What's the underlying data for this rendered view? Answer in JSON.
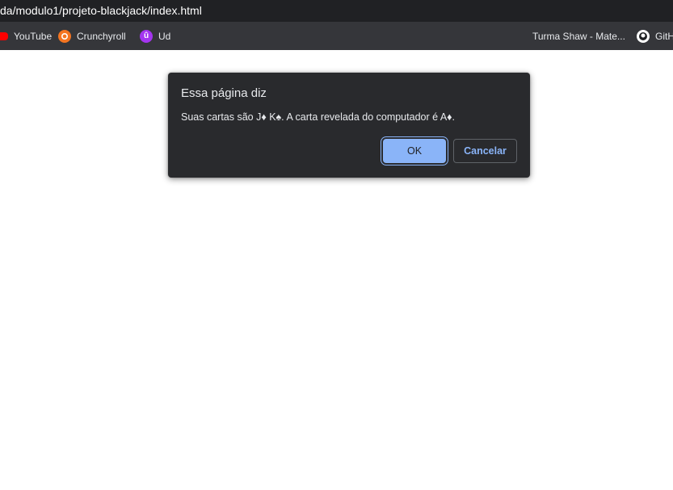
{
  "browser": {
    "url": "da/modulo1/projeto-blackjack/index.html",
    "bookmarks": [
      {
        "label": "YouTube",
        "icon": "youtube-icon"
      },
      {
        "label": "Crunchyroll",
        "icon": "crunchyroll-icon"
      },
      {
        "label": "Ud",
        "icon": "udemy-icon"
      },
      {
        "label": "Turma Shaw - Mate...",
        "icon": ""
      },
      {
        "label": "GitH",
        "icon": "github-icon"
      }
    ]
  },
  "dialog": {
    "title": "Essa página diz",
    "message": "Suas cartas são J♦ K♠. A carta revelada do computador é A♦.",
    "ok_label": "OK",
    "cancel_label": "Cancelar"
  },
  "colors": {
    "dialog_bg": "#292a2d",
    "accent": "#8ab4f8",
    "browser_bar": "#202124",
    "bookmarks_bar": "#35363a"
  }
}
